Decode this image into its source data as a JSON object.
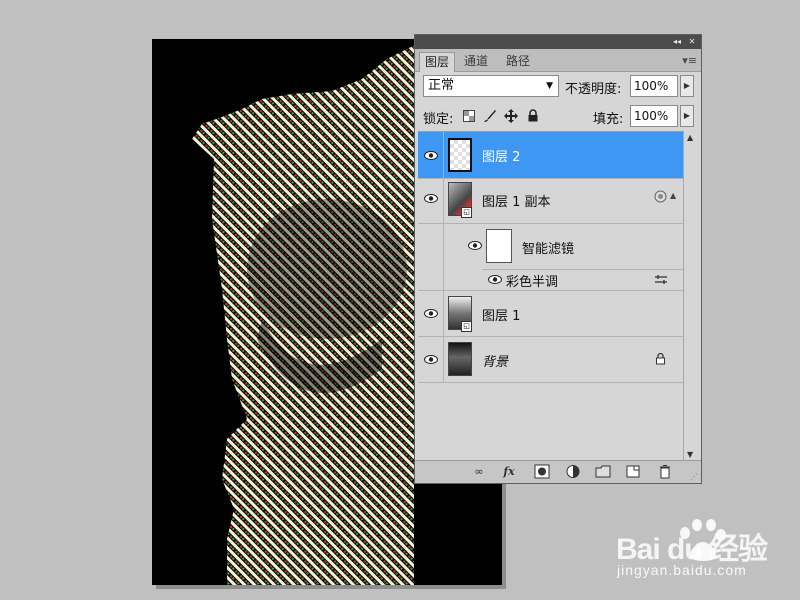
{
  "panel": {
    "tabs": [
      {
        "label": "图层",
        "active": true
      },
      {
        "label": "通道",
        "active": false
      },
      {
        "label": "路径",
        "active": false
      }
    ],
    "blend_mode": "正常",
    "opacity_label": "不透明度:",
    "opacity_value": "100%",
    "lock_label": "锁定:",
    "fill_label": "填充:",
    "fill_value": "100%",
    "layers": [
      {
        "name": "图层 2",
        "selected": true,
        "visible": true
      },
      {
        "name": "图层 1 副本",
        "selected": false,
        "visible": true,
        "smart_object": true
      },
      {
        "name": "智能滤镜",
        "selected": false,
        "visible": true,
        "sub": true
      },
      {
        "name": "彩色半调",
        "selected": false,
        "visible": true,
        "filter": true
      },
      {
        "name": "图层 1",
        "selected": false,
        "visible": true
      },
      {
        "name": "背景",
        "selected": false,
        "visible": true,
        "locked": true
      }
    ],
    "accent_color": "#3d97f3"
  },
  "watermark": {
    "brand": "Bai du 经验",
    "url": "jingyan.baidu.com"
  }
}
